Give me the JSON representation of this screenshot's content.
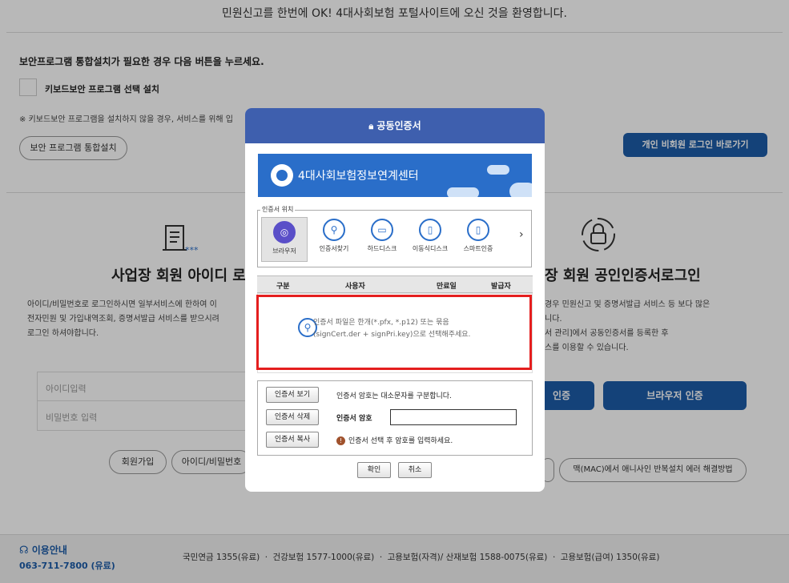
{
  "background": {
    "welcome": "민원신고를 한번에 OK! 4대사회보험 포털사이트에 오신 것을 환영합니다.",
    "security": {
      "title": "보안프로그램 통합설치가 필요한 경우 다음 버튼을 누르세요.",
      "keyboard_label": "키보드보안 프로그램 선택 설치",
      "note": "※ 키보드보안 프로그램을 설치하지 않을 경우, 서비스를 위해 입",
      "install_button": "보안 프로그램 통합설치"
    },
    "guest_login_button": "개인 비회원 로그인 바로가기",
    "left_panel": {
      "title": "사업장 회원 아이디 로",
      "desc1": "아이디/비밀번호로 로그인하시면 일부서비스에 한하여 이",
      "desc2": "전자민원 및 가입내역조회, 증명서발급 서비스를 받으시려",
      "desc3": "로그인 하셔야합니다.",
      "id_placeholder": "아이디입력",
      "pw_placeholder": "비밀번호 입력",
      "join_button": "회원가입",
      "find_button": "아이디/비밀번호"
    },
    "right_panel": {
      "title": "장 회원 공인인증서로그인",
      "desc1": "경우 민원신고 및 증명서발급 서비스 등 보다 많은",
      "desc2": "니다.",
      "desc3": "서 관리]에서 공동인증서를 등록한 후",
      "desc4": "스를 이용할 수 있습니다.",
      "cert_button": "인증",
      "browser_cert_button": "브라우저 인증",
      "mac_help_button": "맥(MAC)에서 애니사인 반복설치 에러 해결방법"
    },
    "footer": {
      "help_title": "이용안내",
      "help_phone": "063-711-7800 (유료)",
      "contacts": "국민연금 1355(유료) ㆍ 건강보험 1577-1000(유료) ㆍ 고용보험(자격)/ 산재보험 1588-0075(유료) ㆍ 고용보험(급여) 1350(유료)"
    }
  },
  "modal": {
    "title": "공동인증서",
    "banner_text": "4대사회보험정보연계센터",
    "location_legend": "인증서 위치",
    "locations": [
      "브라우저",
      "인증서찾기",
      "하드디스크",
      "이동식디스크",
      "스마트인증"
    ],
    "columns": [
      "구분",
      "사용자",
      "만료일",
      "발급자"
    ],
    "empty_line1": "인증서 파일은 한개(*.pfx, *.p12) 또는 묶음",
    "empty_line2": "(signCert.der + signPri.key)으로 선택해주세요.",
    "view_button": "인증서 보기",
    "delete_button": "인증서 삭제",
    "copy_button": "인증서 복사",
    "case_note": "인증서 암호는 대소문자를 구분합니다.",
    "password_label": "인증서 암호",
    "warning_text": "인증서 선택 후 암호를 입력하세요.",
    "confirm_button": "확인",
    "cancel_button": "취소"
  }
}
